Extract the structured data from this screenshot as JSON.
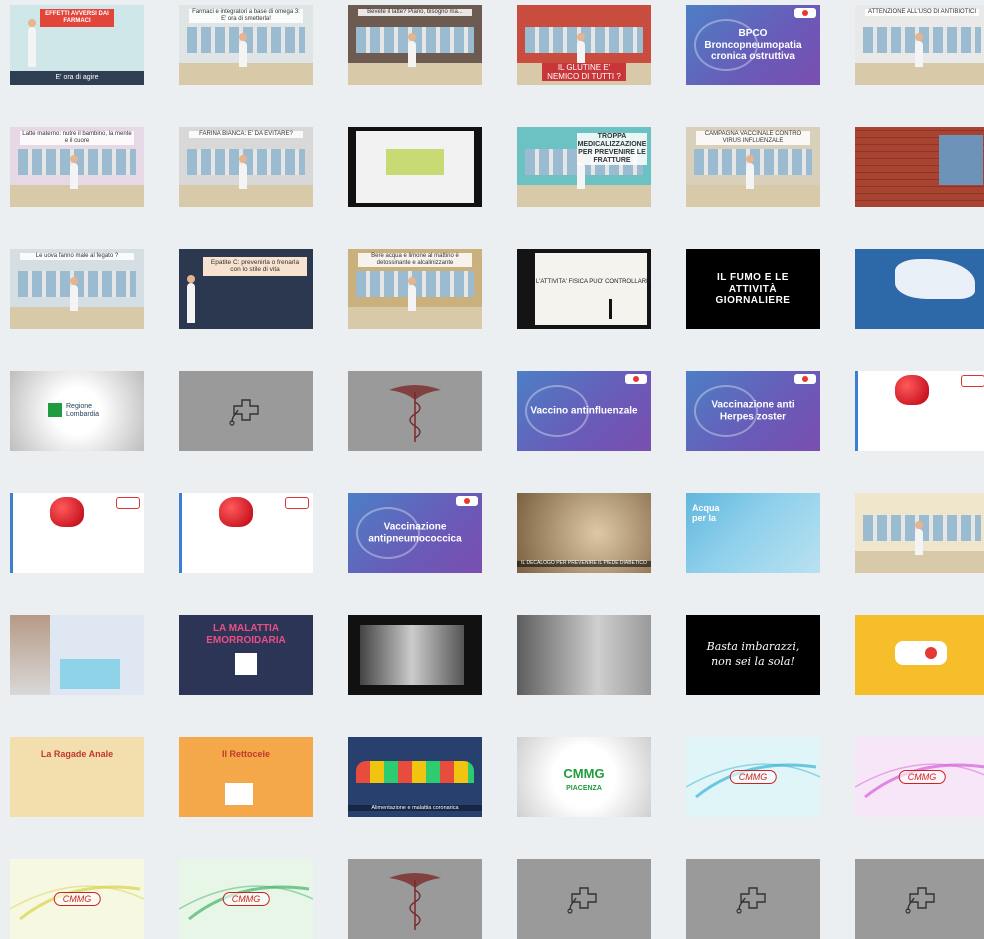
{
  "tiles": [
    {
      "bg": "#cfe7e9",
      "title": "EFFETTI AVVERSI DAI FARMACI",
      "caption": "E' ora di agire",
      "kind": "doctor"
    },
    {
      "bg": "#dfe4e4",
      "title": "Farmaci e integratori a base di omega 3: E' ora di smetterla!",
      "caption": "",
      "kind": "pharmacy"
    },
    {
      "bg": "#6d5a50",
      "title": "Bevete il latte? Piano, bisogno ma...",
      "caption": "",
      "kind": "kitchen"
    },
    {
      "bg": "#c84d3f",
      "title": "",
      "caption": "IL GLUTINE E' NEMICO DI TUTTI ?",
      "kind": "cafe"
    },
    {
      "bg": "",
      "title": "BPCO Broncopneumopatia cronica ostruttiva",
      "caption": "",
      "kind": "med"
    },
    {
      "bg": "#e9e9e9",
      "title": "ATTENZIONE ALL'USO DI ANTIBIOTICI",
      "caption": "",
      "kind": "lab"
    },
    {
      "bg": "#e7d8e6",
      "title": "Latte materno: nutre il bambino, la mente e il cuore",
      "caption": "",
      "kind": "nursery"
    },
    {
      "bg": "#d8d8d8",
      "title": "FARINA BIANCA: E' DA EVITARE?",
      "caption": "",
      "kind": "kitchen2"
    },
    {
      "bg": "#111111",
      "title": "",
      "caption": "",
      "kind": "screen"
    },
    {
      "bg": "#6cc1c3",
      "title": "TROPPA MEDICALIZZAZIONE PER PREVENIRE LE FRATTURE",
      "caption": "",
      "kind": "doctors"
    },
    {
      "bg": "#d9d0bb",
      "title": "CAMPAGNA VACCINALE CONTRO VIRUS INFLUENZALE",
      "caption": "",
      "kind": "office"
    },
    {
      "bg": "#b34a37",
      "title": "",
      "caption": "",
      "kind": "brick"
    },
    {
      "bg": "#d5dfe3",
      "title": "Le uova fanno male al fegato ?",
      "caption": "",
      "kind": "kitchen3"
    },
    {
      "bg": "#2c3850",
      "title": "Epatite C: prevenirla o frenarla con lo stile di vita",
      "caption": "",
      "kind": "doctorDark"
    },
    {
      "bg": "#c9b07d",
      "title": "Bere acqua e limone al mattino è detossinante e alcalinizzante",
      "caption": "",
      "kind": "bar"
    },
    {
      "bg": "#141414",
      "title": "L'ATTIVITA' FISICA PUO' CONTROLLARE",
      "caption": "",
      "kind": "whiteboard"
    },
    {
      "bg": "#000000",
      "title": "IL FUMO E LE ATTIVITÀ GIORNALIERE",
      "caption": "",
      "kind": "black"
    },
    {
      "bg": "#2d68a8",
      "title": "",
      "caption": "",
      "kind": "map"
    },
    {
      "bg": "#efefef",
      "title": "Regione Lombardia",
      "caption": "",
      "kind": "regione"
    },
    {
      "bg": "#9a9a9a",
      "title": "",
      "caption": "",
      "kind": "logo"
    },
    {
      "bg": "#9a9a9a",
      "title": "",
      "caption": "",
      "kind": "caduceus"
    },
    {
      "bg": "",
      "title": "Vaccino antinfluenzale",
      "caption": "",
      "kind": "med"
    },
    {
      "bg": "",
      "title": "Vaccinazione anti Herpes zoster",
      "caption": "",
      "kind": "med"
    },
    {
      "bg": "#ffffff",
      "title": "",
      "caption": "",
      "kind": "heart"
    },
    {
      "bg": "#ffffff",
      "title": "",
      "caption": "",
      "kind": "heart"
    },
    {
      "bg": "#ffffff",
      "title": "",
      "caption": "",
      "kind": "heart"
    },
    {
      "bg": "",
      "title": "Vaccinazione antipneumococcica",
      "caption": "",
      "kind": "med"
    },
    {
      "bg": "#9b8a6c",
      "title": "",
      "caption": "IL DECALOGO PER PREVENIRE IL PIEDE DIABETICO",
      "kind": "feet"
    },
    {
      "bg": "#7cc4e6",
      "title": "Acqua per la",
      "caption": "",
      "kind": "water"
    },
    {
      "bg": "#efe6cc",
      "title": "",
      "caption": "",
      "kind": "pharmacy2"
    },
    {
      "bg": "#dfe8f2",
      "title": "",
      "caption": "",
      "kind": "portrait"
    },
    {
      "bg": "#2d3556",
      "title": "LA MALATTIA EMORROIDARIA",
      "caption": "",
      "kind": "slide"
    },
    {
      "bg": "#111111",
      "title": "",
      "caption": "",
      "kind": "photo"
    },
    {
      "bg": "#8a8a8a",
      "title": "",
      "caption": "",
      "kind": "gray"
    },
    {
      "bg": "#000000",
      "title": "Basta imbarazzi, non sei la sola!",
      "caption": "",
      "kind": "quote"
    },
    {
      "bg": "#f6be2a",
      "title": "",
      "caption": "",
      "kind": "yellowlogo"
    },
    {
      "bg": "#f3dfae",
      "title": "La Ragade Anale",
      "caption": "",
      "kind": "paper"
    },
    {
      "bg": "#f4a84a",
      "title": "Il Rettocele",
      "caption": "",
      "kind": "paper2"
    },
    {
      "bg": "#27406e",
      "title": "",
      "caption": "Alimentazione e malattia coronarica",
      "kind": "food"
    },
    {
      "bg": "#f4f4f4",
      "title": "CMMG",
      "caption": "PIACENZA",
      "kind": "cmmg"
    },
    {
      "bg": "#dff5f7",
      "title": "",
      "caption": "",
      "kind": "swirlBlue"
    },
    {
      "bg": "#f7e6f8",
      "title": "",
      "caption": "",
      "kind": "swirlPink"
    },
    {
      "bg": "#f6f8e2",
      "title": "",
      "caption": "",
      "kind": "swirlYellow"
    },
    {
      "bg": "#e7f6e6",
      "title": "",
      "caption": "",
      "kind": "swirlGreen"
    },
    {
      "bg": "#9a9a9a",
      "title": "",
      "caption": "",
      "kind": "caduceus"
    },
    {
      "bg": "#9a9a9a",
      "title": "",
      "caption": "",
      "kind": "logo"
    },
    {
      "bg": "#9a9a9a",
      "title": "",
      "caption": "",
      "kind": "logo"
    },
    {
      "bg": "#9a9a9a",
      "title": "",
      "caption": "",
      "kind": "logo"
    }
  ],
  "logo_text": {
    "cmmg_small": "CMMG",
    "regione": "Regione Lombardia"
  }
}
